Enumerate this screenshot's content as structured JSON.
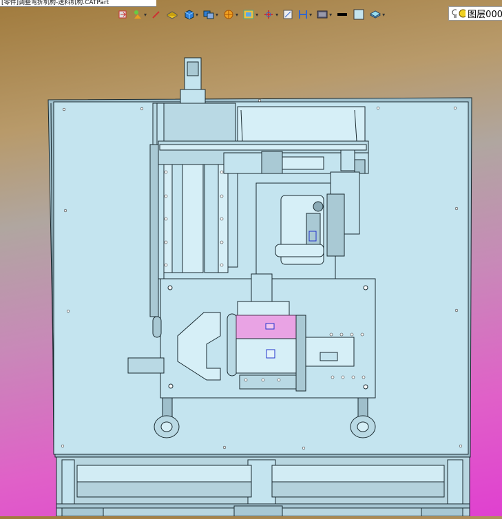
{
  "window": {
    "title": "[零件]调整弯折机构-送料机构.CATPart"
  },
  "toolbar": {
    "items": [
      {
        "icon": "insert-body-icon"
      },
      {
        "icon": "sketch-tools-icon"
      },
      {
        "icon": "edit-pen-icon"
      },
      {
        "icon": "pad-feature-icon"
      },
      {
        "icon": "solid-cube-icon"
      },
      {
        "icon": "boolean-ops-icon"
      },
      {
        "icon": "dress-up-icon"
      },
      {
        "icon": "surface-select-icon"
      },
      {
        "icon": "axis-system-icon"
      },
      {
        "icon": "measure-icon"
      },
      {
        "icon": "section-cut-icon"
      },
      {
        "icon": "view-mode-icon"
      },
      {
        "icon": "line-thickness-icon"
      },
      {
        "icon": "color-fill-icon"
      },
      {
        "icon": "layer-stack-icon"
      }
    ],
    "layer_label": "图层000",
    "colors": {
      "cube_blue": "#2f7fd8",
      "cube_yellow": "#e8c020",
      "accent_orange": "#e07a10"
    }
  },
  "viewport": {
    "background_top": "#a07a3c",
    "background_bottom": "#e040d0",
    "model_color": "#c4e4ef",
    "outline_color": "#1a2a30",
    "highlight_color": "#e9a3e4"
  }
}
